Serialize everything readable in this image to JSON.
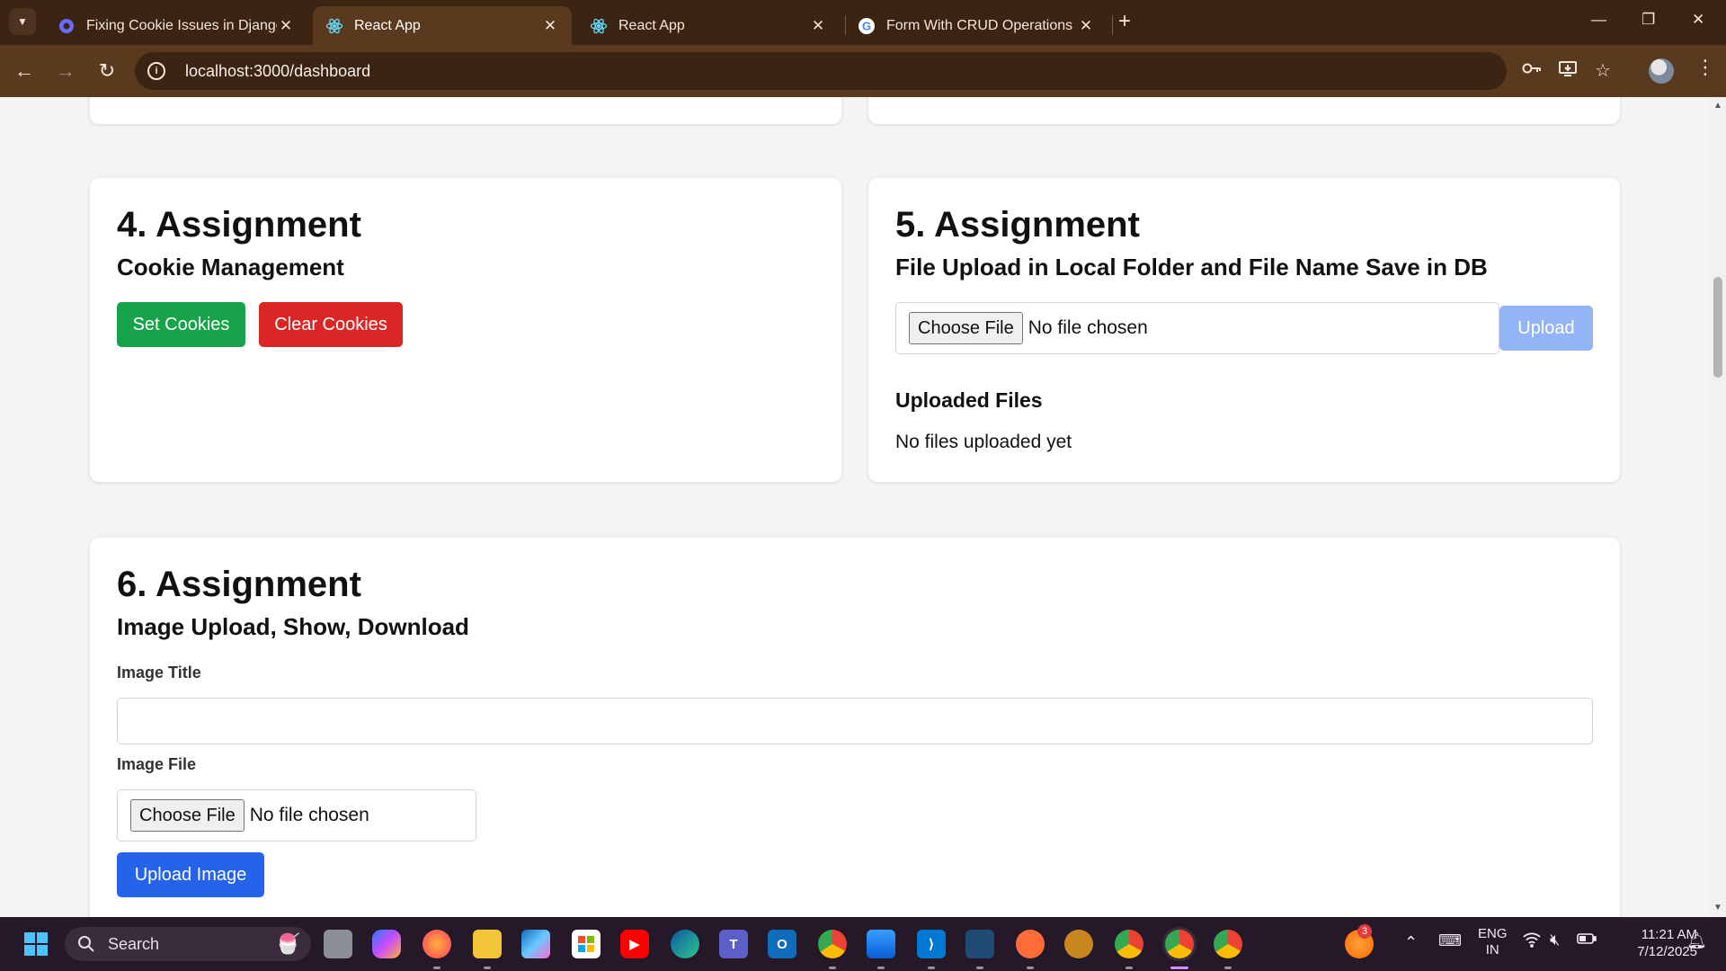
{
  "browser": {
    "tabs": [
      {
        "title": "Fixing Cookie Issues in Django I",
        "active": false
      },
      {
        "title": "React App",
        "active": true
      },
      {
        "title": "React App",
        "active": false
      },
      {
        "title": "Form With CRUD Operations - G",
        "active": false
      }
    ],
    "url": "localhost:3000/dashboard"
  },
  "assignment4": {
    "heading": "4. Assignment",
    "subheading": "Cookie Management",
    "set_cookies_label": "Set Cookies",
    "clear_cookies_label": "Clear Cookies"
  },
  "assignment5": {
    "heading": "5. Assignment",
    "subheading": "File Upload in Local Folder and File Name Save in DB",
    "choose_file_label": "Choose File",
    "file_status": "No file chosen",
    "upload_label": "Upload",
    "uploaded_files_title": "Uploaded Files",
    "empty_message": "No files uploaded yet"
  },
  "assignment6": {
    "heading": "6. Assignment",
    "subheading": "Image Upload, Show, Download",
    "image_title_label": "Image Title",
    "image_title_value": "",
    "image_file_label": "Image File",
    "choose_file_label": "Choose File",
    "file_status": "No file chosen",
    "upload_image_label": "Upload Image"
  },
  "taskbar": {
    "search_label": "Search",
    "notification_count": "3",
    "language": "ENG",
    "region": "IN",
    "time": "11:21 AM",
    "date": "7/12/2025"
  },
  "colors": {
    "green_button": "#16a34a",
    "red_button": "#dc2626",
    "blue_button": "#2563eb",
    "disabled_blue_button": "#93b4f5"
  }
}
